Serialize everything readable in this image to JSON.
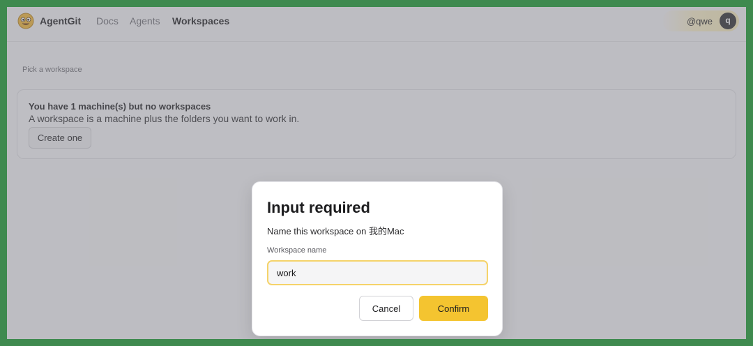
{
  "header": {
    "brand": "AgentGit",
    "logo_icon": "smiley-face-logo",
    "nav": [
      {
        "label": "Docs",
        "active": false
      },
      {
        "label": "Agents",
        "active": false
      },
      {
        "label": "Workspaces",
        "active": true
      }
    ],
    "username": "@qwe",
    "avatar_letter": "q"
  },
  "main": {
    "pick_label": "Pick a workspace",
    "empty_state": {
      "title": "You have 1 machine(s) but no workspaces",
      "description": "A workspace is a machine plus the folders you want to work in.",
      "create_button": "Create one"
    }
  },
  "dialog": {
    "title": "Input required",
    "subtitle": "Name this workspace on 我的Mac",
    "field_label": "Workspace name",
    "field_value": "work",
    "cancel_label": "Cancel",
    "confirm_label": "Confirm"
  },
  "colors": {
    "accent": "#f4c430",
    "focus_ring": "#f5d36a",
    "background_frame": "#3f8a4f"
  }
}
